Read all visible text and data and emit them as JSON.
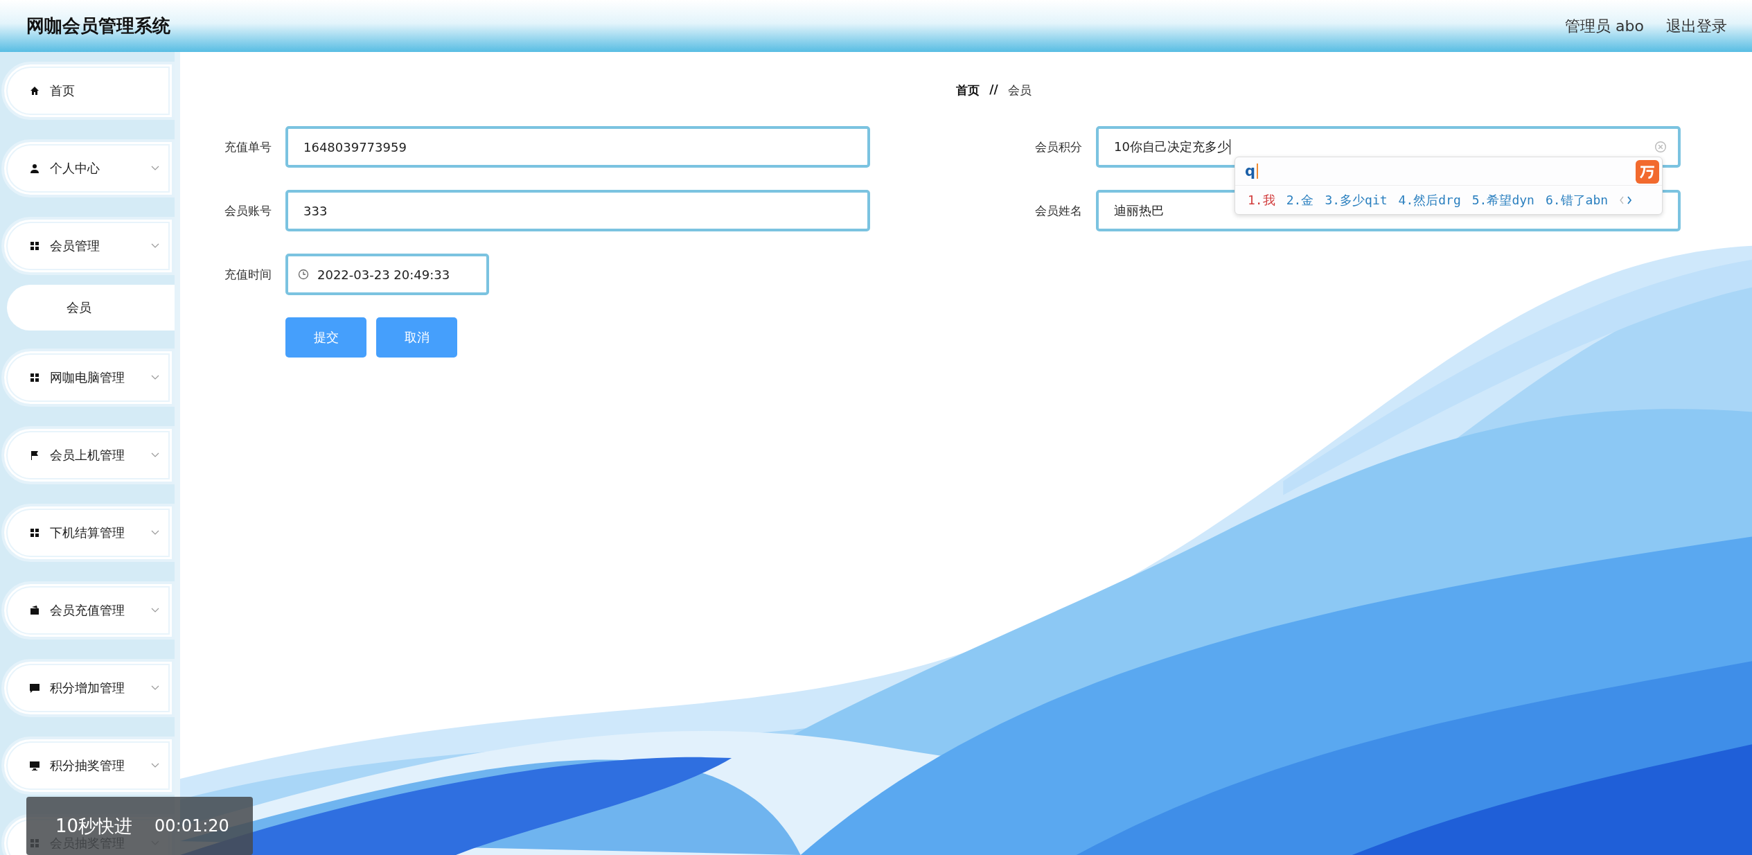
{
  "header": {
    "title": "网咖会员管理系统",
    "user": "管理员 abo",
    "logout": "退出登录"
  },
  "sidebar": {
    "items": [
      {
        "label": "首页",
        "kind": "link"
      },
      {
        "label": "个人中心",
        "kind": "menu"
      },
      {
        "label": "会员管理",
        "kind": "menu",
        "children": [
          {
            "label": "会员"
          }
        ]
      },
      {
        "label": "网咖电脑管理",
        "kind": "menu"
      },
      {
        "label": "会员上机管理",
        "kind": "menu"
      },
      {
        "label": "下机结算管理",
        "kind": "menu"
      },
      {
        "label": "会员充值管理",
        "kind": "menu"
      },
      {
        "label": "积分增加管理",
        "kind": "menu"
      },
      {
        "label": "积分抽奖管理",
        "kind": "menu"
      },
      {
        "label": "会员抽奖管理",
        "kind": "menu"
      }
    ]
  },
  "breadcrumb": {
    "home": "首页",
    "separator": "//",
    "current": "会员"
  },
  "form": {
    "left": [
      {
        "label": "充值单号",
        "value": "1648039773959",
        "kind": "text"
      },
      {
        "label": "会员账号",
        "value": "333",
        "kind": "text"
      },
      {
        "label": "充值时间",
        "value": "2022-03-23 20:49:33",
        "kind": "datetime"
      }
    ],
    "right": [
      {
        "label": "会员积分",
        "value": "10你自己决定充多少",
        "focused": true,
        "clearable": true
      },
      {
        "label": "会员姓名",
        "value": "迪丽热巴"
      }
    ],
    "buttons": [
      "提交",
      "取消"
    ]
  },
  "ime": {
    "input": "q",
    "candidates": [
      {
        "text": "1.我",
        "selected": true
      },
      {
        "text": "2.金",
        "selected": false
      },
      {
        "text": "3.多少qit",
        "selected": false
      },
      {
        "text": "4.然后drg",
        "selected": false
      },
      {
        "text": "5.希望dyn",
        "selected": false
      },
      {
        "text": "6.错了abn",
        "selected": false
      }
    ]
  },
  "player_overlay": {
    "label": "10秒快进",
    "time": "00:01:20"
  }
}
